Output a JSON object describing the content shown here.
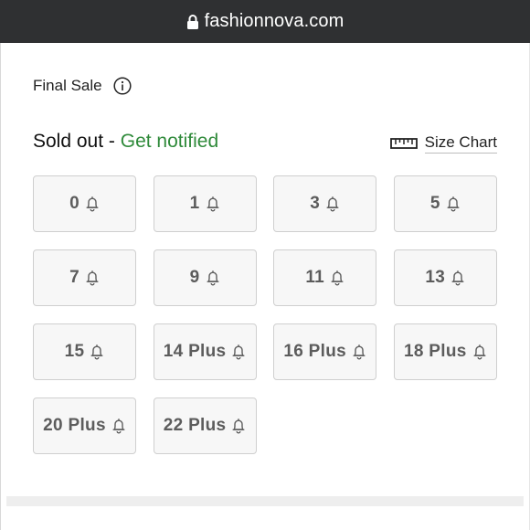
{
  "browser": {
    "url": "fashionnova.com"
  },
  "product": {
    "final_sale_label": "Final Sale",
    "sold_out_text": "Sold out",
    "separator": " - ",
    "notify_text": "Get notified",
    "notify_color": "#2f8a3a",
    "size_chart_label": "Size Chart"
  },
  "sizes": [
    {
      "label": "0",
      "icon": "bell-icon"
    },
    {
      "label": "1",
      "icon": "bell-icon"
    },
    {
      "label": "3",
      "icon": "bell-icon"
    },
    {
      "label": "5",
      "icon": "bell-icon"
    },
    {
      "label": "7",
      "icon": "bell-icon"
    },
    {
      "label": "9",
      "icon": "bell-icon"
    },
    {
      "label": "11",
      "icon": "bell-icon"
    },
    {
      "label": "13",
      "icon": "bell-icon"
    },
    {
      "label": "15",
      "icon": "bell-icon"
    },
    {
      "label": "14 Plus",
      "icon": "bell-icon"
    },
    {
      "label": "16 Plus",
      "icon": "bell-icon"
    },
    {
      "label": "18 Plus",
      "icon": "bell-icon"
    },
    {
      "label": "20 Plus",
      "icon": "bell-icon"
    },
    {
      "label": "22 Plus",
      "icon": "bell-icon"
    }
  ],
  "icons": {
    "lock": "lock-icon",
    "info": "info-icon",
    "ruler": "ruler-icon",
    "bell": "bell-icon"
  }
}
